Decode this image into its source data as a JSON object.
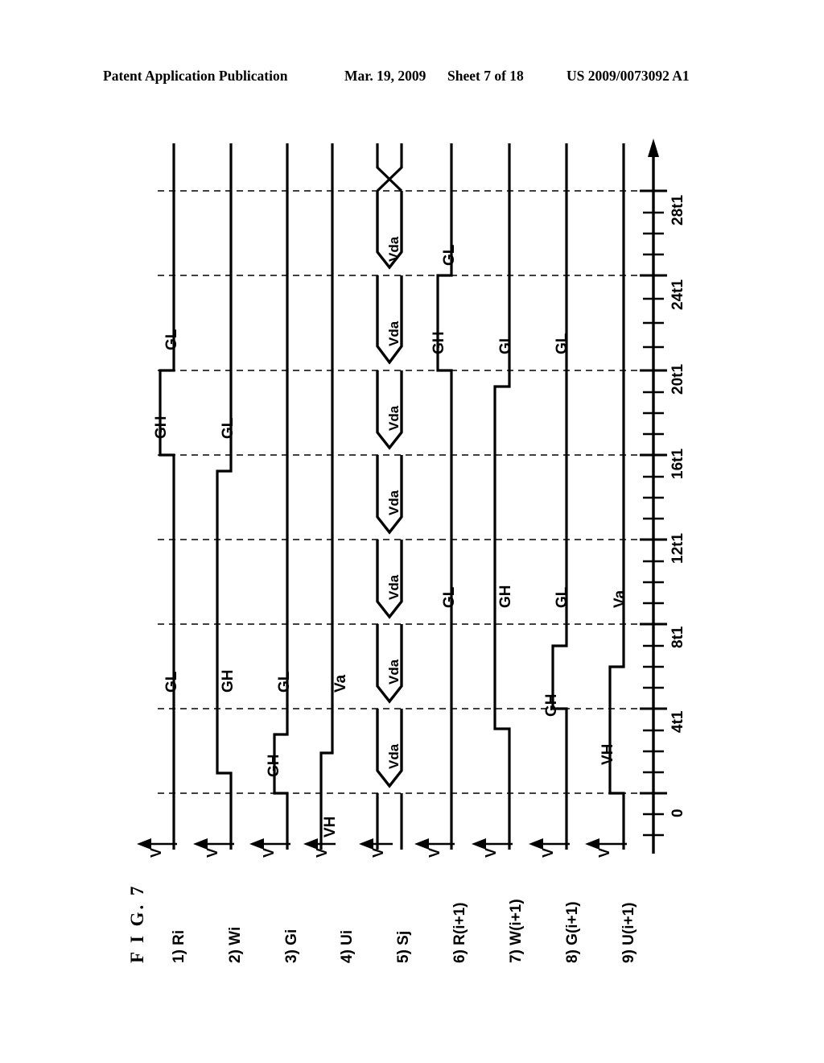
{
  "header": {
    "publication": "Patent Application Publication",
    "date": "Mar. 19, 2009",
    "sheet": "Sheet 7 of 18",
    "number": "US 2009/0073092 A1"
  },
  "figure": {
    "title": "F I G.  7",
    "axis_voltage_label": "V",
    "time_axis": {
      "ticks_major": [
        "0",
        "4t1",
        "8t1",
        "12t1",
        "16t1",
        "20t1",
        "24t1",
        "28t1"
      ],
      "minor_per_major": 4,
      "direction": "upward-arrow"
    },
    "rows": [
      {
        "index": "1",
        "label": "1) Ri",
        "segments": [
          {
            "level": "low",
            "label": "GL",
            "from": "0",
            "to": "8t1"
          },
          {
            "level": "high",
            "label": "GH",
            "from": "8t1",
            "to": "12t1"
          },
          {
            "level": "low",
            "label": "GL",
            "from": "12t1",
            "to": "28t1"
          }
        ]
      },
      {
        "index": "2",
        "label": "2) Wi",
        "segments": [
          {
            "level": "high",
            "label": "GH",
            "from": "0",
            "to": "12t1"
          },
          {
            "level": "low",
            "label": "GL",
            "from": "12t1",
            "to": "28t1"
          }
        ]
      },
      {
        "index": "3",
        "label": "3) Gi",
        "segments": [
          {
            "level": "low",
            "label": "GL",
            "from": "0",
            "to": "1t1"
          },
          {
            "level": "high",
            "label": "GH",
            "from": "1t1",
            "to": "3t1"
          },
          {
            "level": "low",
            "label": "GL",
            "from": "3t1",
            "to": "28t1"
          }
        ]
      },
      {
        "index": "4",
        "label": "4) Ui",
        "segments": [
          {
            "level": "high",
            "label": "VH",
            "from": "0",
            "to": "2t1"
          },
          {
            "level": "low",
            "label": "Va",
            "from": "2t1",
            "to": "28t1"
          }
        ]
      },
      {
        "index": "5",
        "label": "5) Sj",
        "bus": true,
        "bus_label": "Vda",
        "bus_segments": 8
      },
      {
        "index": "6",
        "label": "6) R(i+1)",
        "segments": [
          {
            "level": "low",
            "label": "GL",
            "from": "0",
            "to": "16t1"
          },
          {
            "level": "high",
            "label": "GH",
            "from": "16t1",
            "to": "20t1"
          },
          {
            "level": "low",
            "label": "GL",
            "from": "20t1",
            "to": "28t1"
          }
        ]
      },
      {
        "index": "7",
        "label": "7) W(i+1)",
        "segments": [
          {
            "level": "low",
            "label": "GL",
            "from": "0",
            "to": "3t1"
          },
          {
            "level": "high",
            "label": "GH",
            "from": "3t1",
            "to": "16t1"
          },
          {
            "level": "low",
            "label": "GL",
            "from": "16t1",
            "to": "28t1"
          }
        ]
      },
      {
        "index": "8",
        "label": "8) G(i+1)",
        "segments": [
          {
            "level": "low",
            "label": "GL",
            "from": "0",
            "to": "5t1"
          },
          {
            "level": "high",
            "label": "GH",
            "from": "5t1",
            "to": "7t1"
          },
          {
            "level": "low",
            "label": "GL",
            "from": "7t1",
            "to": "28t1"
          }
        ]
      },
      {
        "index": "9",
        "label": "9) U(i+1)",
        "segments": [
          {
            "level": "low",
            "label": "Va",
            "from": "0",
            "to": "1t1"
          },
          {
            "level": "high",
            "label": "VH",
            "from": "1t1",
            "to": "7t1"
          },
          {
            "level": "low",
            "label": "Va",
            "from": "7t1",
            "to": "28t1"
          }
        ]
      }
    ]
  },
  "colors": {
    "ink": "#000000",
    "paper": "#ffffff"
  }
}
